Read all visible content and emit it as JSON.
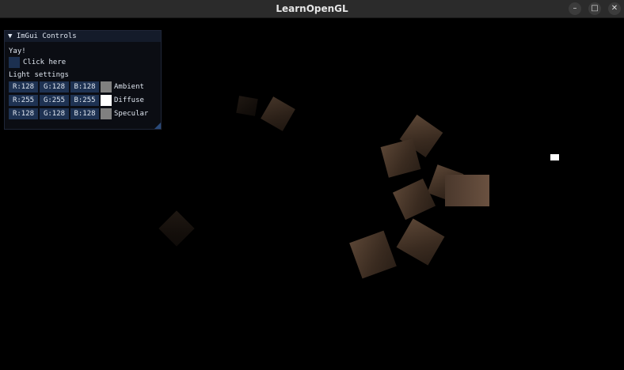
{
  "window": {
    "title": "LearnOpenGL",
    "minimize": "–",
    "maximize": "□",
    "close": "✕"
  },
  "imgui": {
    "title": "ImGui Controls",
    "collapse_icon": "▼",
    "text": "Yay!",
    "checkbox_label": "Click here",
    "section": "Light settings",
    "rows": [
      {
        "r": "R:128",
        "g": "G:128",
        "b": "B:128",
        "swatch": "#808080",
        "label": "Ambient"
      },
      {
        "r": "R:255",
        "g": "G:255",
        "b": "B:255",
        "swatch": "#ffffff",
        "label": "Diffuse"
      },
      {
        "r": "R:128",
        "g": "G:128",
        "b": "B:128",
        "swatch": "#808080",
        "label": "Specular"
      }
    ]
  }
}
